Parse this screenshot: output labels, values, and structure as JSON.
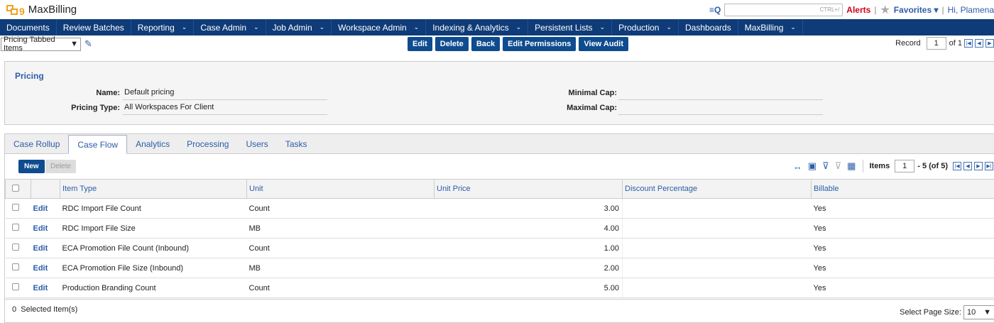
{
  "app": {
    "name": "MaxBilling",
    "logo_suffix": "9"
  },
  "header": {
    "search_hint": "CTRL+/",
    "alerts": "Alerts",
    "favorites": "Favorites",
    "greeting": "Hi, Plamena"
  },
  "nav": {
    "items": [
      {
        "label": "Documents",
        "chevron": false
      },
      {
        "label": "Review Batches",
        "chevron": false
      },
      {
        "label": "Reporting",
        "chevron": true
      },
      {
        "label": "Case Admin",
        "chevron": true
      },
      {
        "label": "Job Admin",
        "chevron": true
      },
      {
        "label": "Workspace Admin",
        "chevron": true
      },
      {
        "label": "Indexing & Analytics",
        "chevron": true
      },
      {
        "label": "Persistent Lists",
        "chevron": true
      },
      {
        "label": "Production",
        "chevron": true
      },
      {
        "label": "Dashboards",
        "chevron": false
      },
      {
        "label": "MaxBilling",
        "chevron": true
      }
    ]
  },
  "toolbar": {
    "view": "Pricing Tabbed Items",
    "buttons": [
      "Edit",
      "Delete",
      "Back",
      "Edit Permissions",
      "View Audit"
    ],
    "record_label": "Record",
    "record_value": "1",
    "record_of": "of 1"
  },
  "pricing": {
    "title": "Pricing",
    "name_label": "Name:",
    "name_value": "Default pricing",
    "type_label": "Pricing Type:",
    "type_value": "All Workspaces For Client",
    "min_cap_label": "Minimal Cap:",
    "min_cap_value": "",
    "max_cap_label": "Maximal Cap:",
    "max_cap_value": ""
  },
  "tabs": [
    "Case Rollup",
    "Case Flow",
    "Analytics",
    "Processing",
    "Users",
    "Tasks"
  ],
  "active_tab": "Case Flow",
  "grid": {
    "new_label": "New",
    "delete_label": "Delete",
    "items_label": "Items",
    "items_page": "1",
    "items_range": "- 5 (of 5)",
    "columns": [
      "Item Type",
      "Unit",
      "Unit Price",
      "Discount Percentage",
      "Billable"
    ],
    "edit_label": "Edit",
    "rows": [
      {
        "item_type": "RDC Import File Count",
        "unit": "Count",
        "unit_price": "3.00",
        "discount": "",
        "billable": "Yes"
      },
      {
        "item_type": "RDC Import File Size",
        "unit": "MB",
        "unit_price": "4.00",
        "discount": "",
        "billable": "Yes"
      },
      {
        "item_type": "ECA Promotion File Count (Inbound)",
        "unit": "Count",
        "unit_price": "1.00",
        "discount": "",
        "billable": "Yes"
      },
      {
        "item_type": "ECA Promotion File Size (Inbound)",
        "unit": "MB",
        "unit_price": "2.00",
        "discount": "",
        "billable": "Yes"
      },
      {
        "item_type": "Production Branding Count",
        "unit": "Count",
        "unit_price": "5.00",
        "discount": "",
        "billable": "Yes"
      }
    ],
    "selected_count": "0",
    "selected_label": "Selected Item(s)",
    "page_size_label": "Select Page Size:",
    "page_size": "10"
  },
  "colors": {
    "nav_bg": "#0f3c78",
    "button_bg": "#0f4b8f",
    "link": "#2b5da8",
    "alert": "#d0021b",
    "logo": "#f0a020"
  }
}
